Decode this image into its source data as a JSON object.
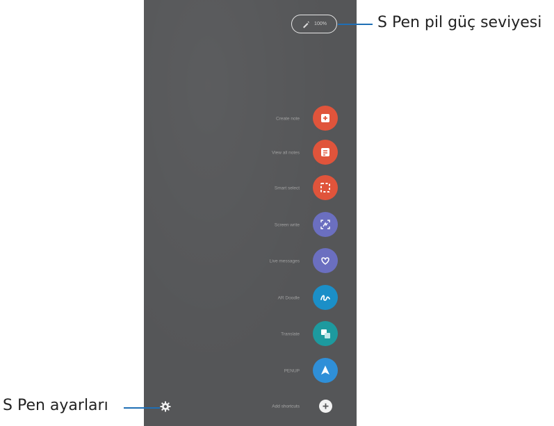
{
  "battery": {
    "text": "100%",
    "icon": "s-pen-icon"
  },
  "menu": [
    {
      "label": "Create note",
      "icon": "create-note-icon",
      "color": "#e0543b"
    },
    {
      "label": "View all notes",
      "icon": "view-all-notes-icon",
      "color": "#e0543b"
    },
    {
      "label": "Smart select",
      "icon": "smart-select-icon",
      "color": "#e0543b"
    },
    {
      "label": "Screen write",
      "icon": "screen-write-icon",
      "color": "#6b6fc0"
    },
    {
      "label": "Live messages",
      "icon": "live-messages-icon",
      "color": "#6b6fc0"
    },
    {
      "label": "AR Doodle",
      "icon": "ar-doodle-icon",
      "color": "#1b8fc8"
    },
    {
      "label": "Translate",
      "icon": "translate-icon",
      "color": "#1d9a9f"
    },
    {
      "label": "PENUP",
      "icon": "penup-icon",
      "color": "#2f8fd8"
    }
  ],
  "add_shortcut": {
    "label": "Add shortcuts",
    "icon": "plus-icon"
  },
  "settings": {
    "icon": "gear-icon"
  },
  "callouts": {
    "battery": "S Pen pil güç seviyesi",
    "settings": "S Pen ayarları"
  },
  "colors": {
    "panel": "#555658",
    "callout_line": "#1f6fb5"
  }
}
